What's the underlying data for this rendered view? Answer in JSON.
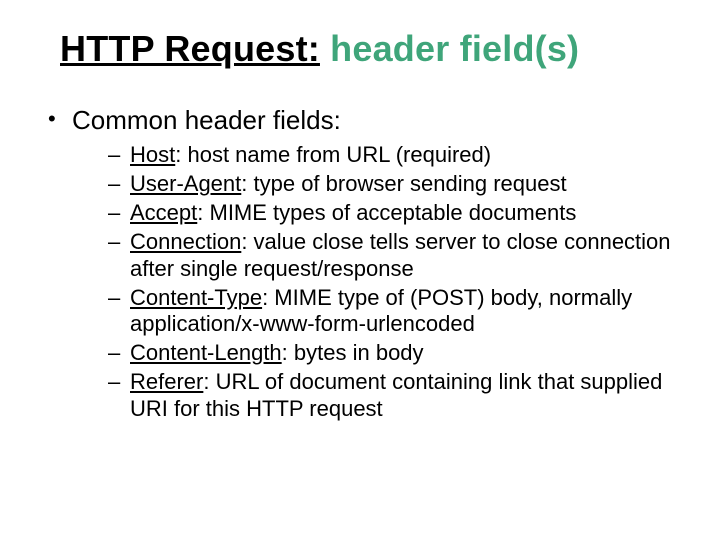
{
  "title": {
    "part1": "HTTP Request:",
    "part2": " header field(s)"
  },
  "bullet": {
    "heading": "Common header fields:"
  },
  "fields": [
    {
      "term": "Host",
      "desc": ": host name from URL (required)"
    },
    {
      "term": "User-Agent",
      "desc": ": type of browser sending request"
    },
    {
      "term": "Accept",
      "desc": ": MIME types of acceptable documents"
    },
    {
      "term": "Connection",
      "desc": ": value close tells server to close connection after single request/response"
    },
    {
      "term": "Content-Type",
      "desc": ": MIME type of (POST) body, normally application/x-www-form-urlencoded"
    },
    {
      "term": "Content-Length",
      "desc": ": bytes in body"
    },
    {
      "term": "Referer",
      "desc": ": URL of document containing link that supplied URI for this HTTP request"
    }
  ]
}
